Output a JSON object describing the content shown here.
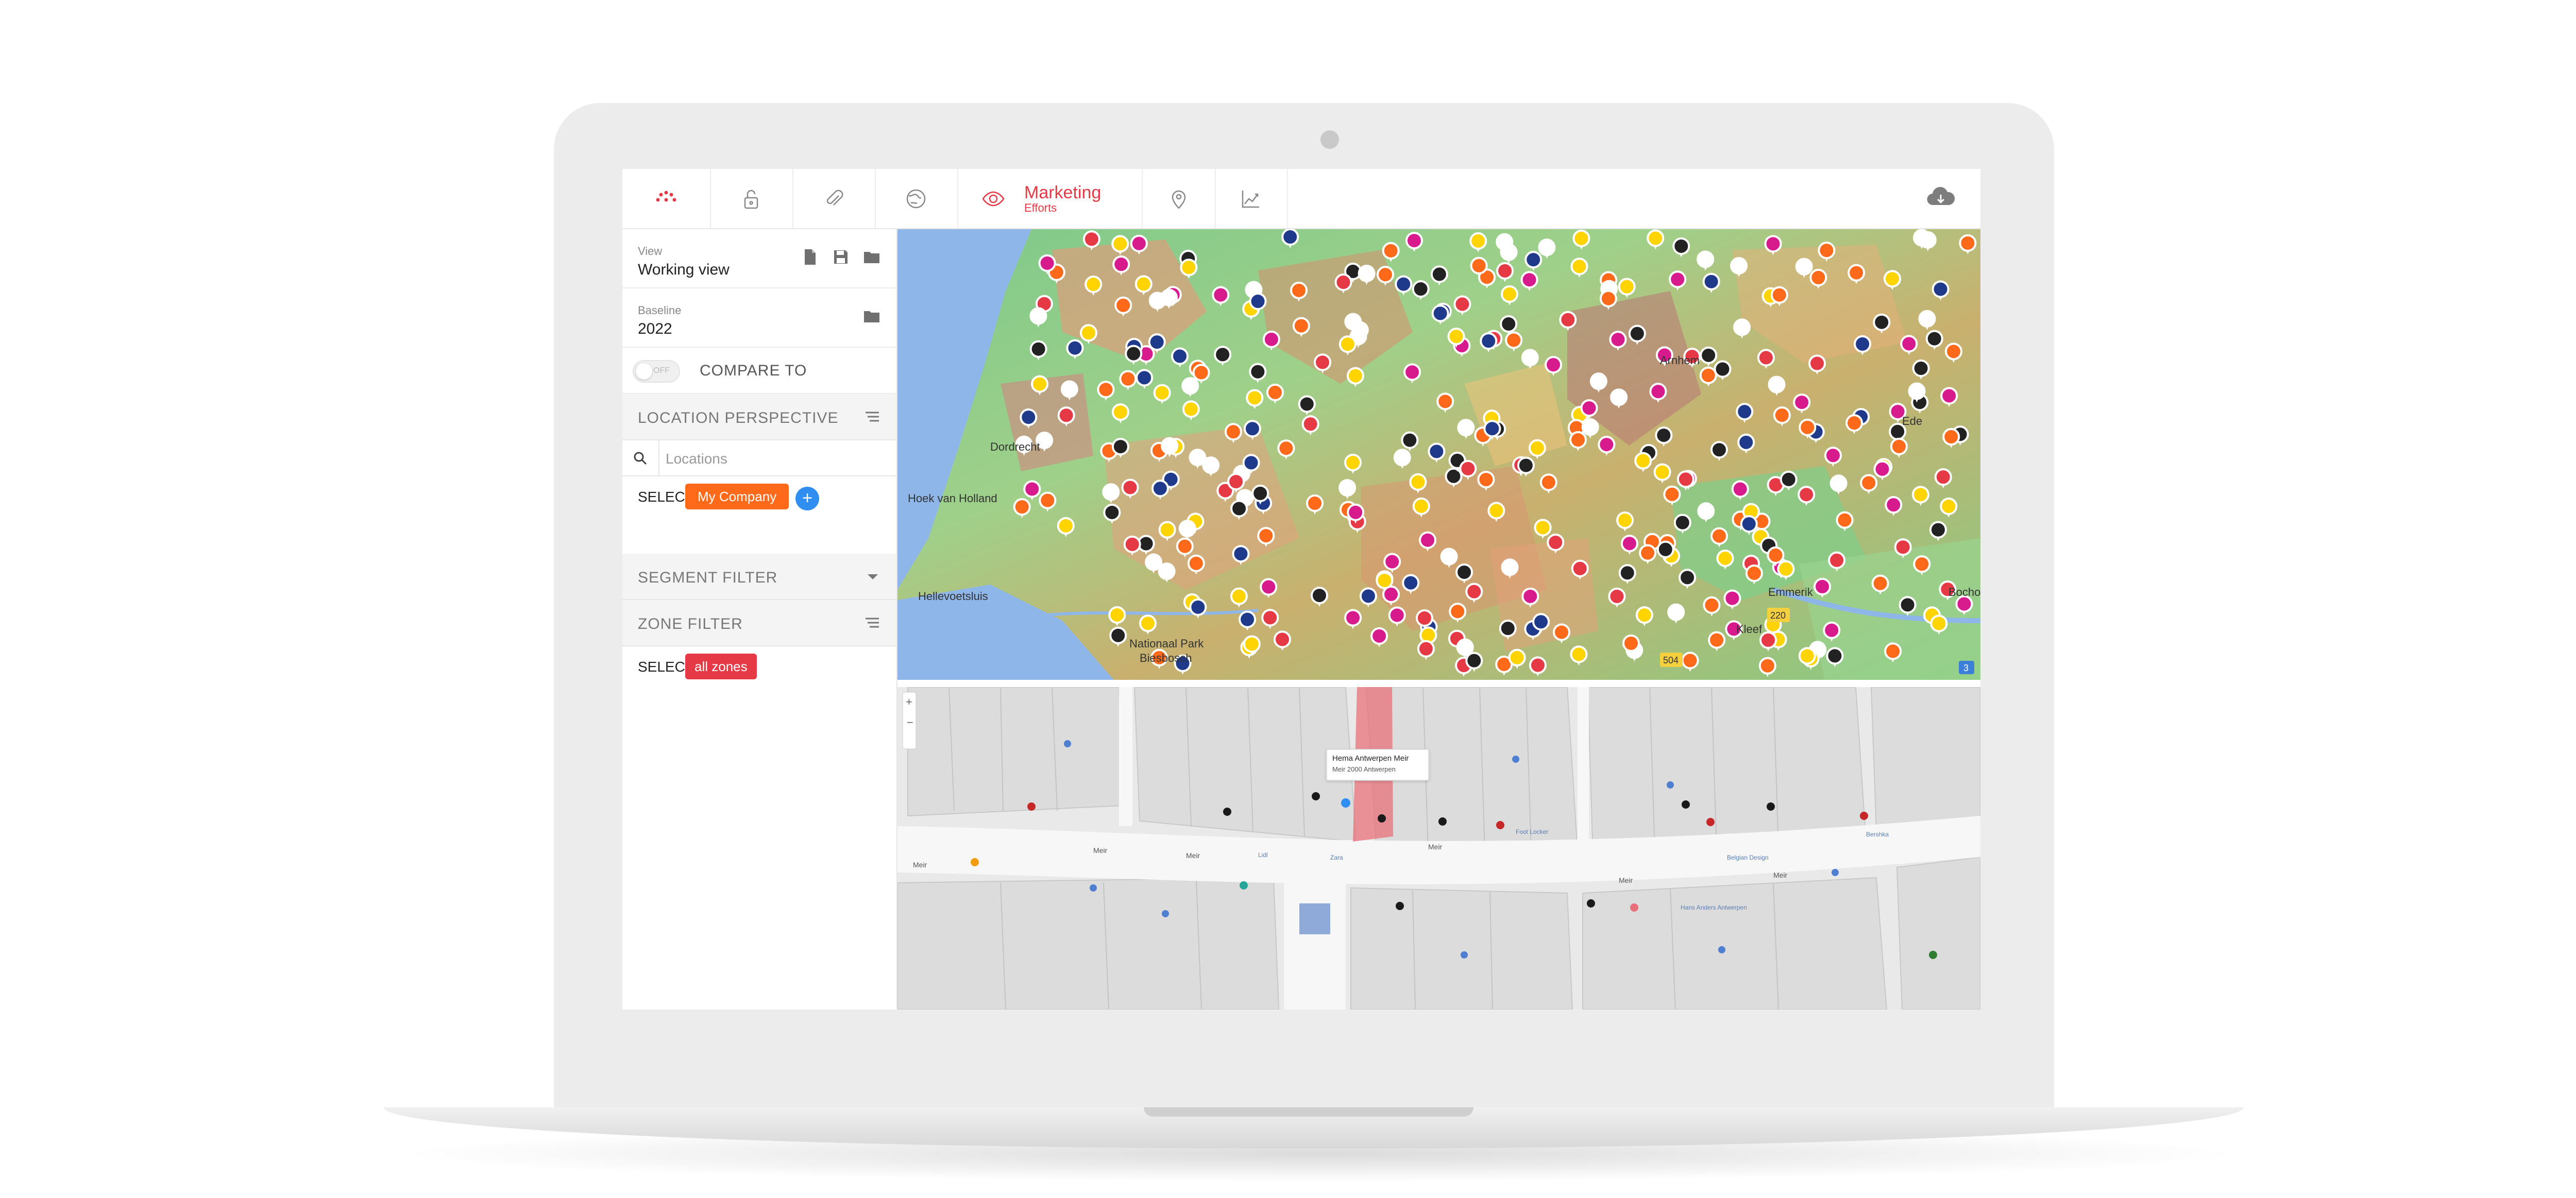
{
  "app": {
    "tabs": [
      {
        "id": "logo",
        "icon": "dots-logo-icon"
      },
      {
        "id": "lock",
        "icon": "lock-icon"
      },
      {
        "id": "attach",
        "icon": "paperclip-icon"
      },
      {
        "id": "globe",
        "icon": "globe-icon"
      },
      {
        "id": "marketing",
        "icon": "eye-icon",
        "title": "Marketing",
        "subtitle": "Efforts"
      },
      {
        "id": "location",
        "icon": "location-pin-icon"
      },
      {
        "id": "analytics",
        "icon": "trend-chart-icon"
      }
    ],
    "cloud_icon": "cloud-download-icon",
    "accent_color": "#e63946"
  },
  "sidebar": {
    "view": {
      "label": "View",
      "value": "Working view"
    },
    "baseline": {
      "label": "Baseline",
      "value": "2022"
    },
    "compare": {
      "toggle_text": "OFF",
      "label": "COMPARE TO"
    },
    "location_perspective": {
      "title": "LOCATION PERSPECTIVE"
    },
    "search": {
      "placeholder": "Locations"
    },
    "select_company": {
      "label": "SELECT",
      "chip": "My Company",
      "chip_color": "#ff6a1a"
    },
    "segment_filter": {
      "title": "SEGMENT FILTER"
    },
    "zone_filter": {
      "title": "ZONE FILTER"
    },
    "select_zones": {
      "label": "SELECT",
      "chip": "all zones",
      "chip_color": "#e63946"
    }
  },
  "map_top": {
    "place_labels": [
      "Emmerik",
      "Bocholt",
      "Kleef",
      "Nationaal Park",
      "Biesbosch",
      "Ede",
      "Arnhem",
      "Dordrecht",
      "Hoek van Holland",
      "Hellevoetsluis"
    ],
    "road_badges": [
      "220",
      "504",
      "3"
    ]
  },
  "map_bottom": {
    "popup": {
      "title": "Hema Antwerpen Meir",
      "address": "Meir 2000 Antwerpen"
    },
    "street_labels": [
      "Meir",
      "Meir",
      "Meir",
      "Meir",
      "Meir",
      "Meir"
    ],
    "poi_labels": [
      "Lidl",
      "Zara",
      "Belgian Design",
      "Hans Anders Antwerpen",
      "Bershka",
      "Foot Locker"
    ]
  }
}
